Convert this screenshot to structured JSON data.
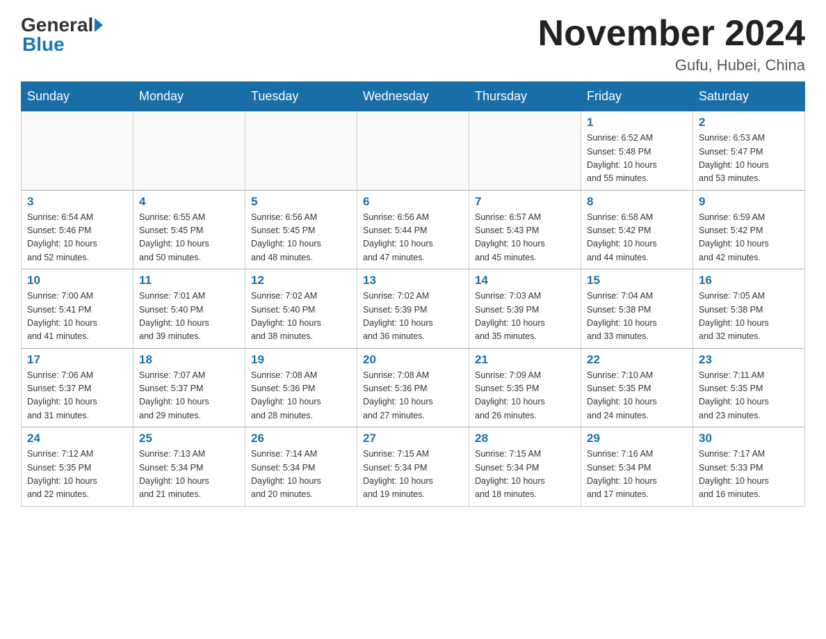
{
  "header": {
    "logo_general": "General",
    "logo_blue": "Blue",
    "title": "November 2024",
    "subtitle": "Gufu, Hubei, China"
  },
  "weekdays": [
    "Sunday",
    "Monday",
    "Tuesday",
    "Wednesday",
    "Thursday",
    "Friday",
    "Saturday"
  ],
  "weeks": [
    [
      {
        "day": "",
        "info": ""
      },
      {
        "day": "",
        "info": ""
      },
      {
        "day": "",
        "info": ""
      },
      {
        "day": "",
        "info": ""
      },
      {
        "day": "",
        "info": ""
      },
      {
        "day": "1",
        "info": "Sunrise: 6:52 AM\nSunset: 5:48 PM\nDaylight: 10 hours\nand 55 minutes."
      },
      {
        "day": "2",
        "info": "Sunrise: 6:53 AM\nSunset: 5:47 PM\nDaylight: 10 hours\nand 53 minutes."
      }
    ],
    [
      {
        "day": "3",
        "info": "Sunrise: 6:54 AM\nSunset: 5:46 PM\nDaylight: 10 hours\nand 52 minutes."
      },
      {
        "day": "4",
        "info": "Sunrise: 6:55 AM\nSunset: 5:45 PM\nDaylight: 10 hours\nand 50 minutes."
      },
      {
        "day": "5",
        "info": "Sunrise: 6:56 AM\nSunset: 5:45 PM\nDaylight: 10 hours\nand 48 minutes."
      },
      {
        "day": "6",
        "info": "Sunrise: 6:56 AM\nSunset: 5:44 PM\nDaylight: 10 hours\nand 47 minutes."
      },
      {
        "day": "7",
        "info": "Sunrise: 6:57 AM\nSunset: 5:43 PM\nDaylight: 10 hours\nand 45 minutes."
      },
      {
        "day": "8",
        "info": "Sunrise: 6:58 AM\nSunset: 5:42 PM\nDaylight: 10 hours\nand 44 minutes."
      },
      {
        "day": "9",
        "info": "Sunrise: 6:59 AM\nSunset: 5:42 PM\nDaylight: 10 hours\nand 42 minutes."
      }
    ],
    [
      {
        "day": "10",
        "info": "Sunrise: 7:00 AM\nSunset: 5:41 PM\nDaylight: 10 hours\nand 41 minutes."
      },
      {
        "day": "11",
        "info": "Sunrise: 7:01 AM\nSunset: 5:40 PM\nDaylight: 10 hours\nand 39 minutes."
      },
      {
        "day": "12",
        "info": "Sunrise: 7:02 AM\nSunset: 5:40 PM\nDaylight: 10 hours\nand 38 minutes."
      },
      {
        "day": "13",
        "info": "Sunrise: 7:02 AM\nSunset: 5:39 PM\nDaylight: 10 hours\nand 36 minutes."
      },
      {
        "day": "14",
        "info": "Sunrise: 7:03 AM\nSunset: 5:39 PM\nDaylight: 10 hours\nand 35 minutes."
      },
      {
        "day": "15",
        "info": "Sunrise: 7:04 AM\nSunset: 5:38 PM\nDaylight: 10 hours\nand 33 minutes."
      },
      {
        "day": "16",
        "info": "Sunrise: 7:05 AM\nSunset: 5:38 PM\nDaylight: 10 hours\nand 32 minutes."
      }
    ],
    [
      {
        "day": "17",
        "info": "Sunrise: 7:06 AM\nSunset: 5:37 PM\nDaylight: 10 hours\nand 31 minutes."
      },
      {
        "day": "18",
        "info": "Sunrise: 7:07 AM\nSunset: 5:37 PM\nDaylight: 10 hours\nand 29 minutes."
      },
      {
        "day": "19",
        "info": "Sunrise: 7:08 AM\nSunset: 5:36 PM\nDaylight: 10 hours\nand 28 minutes."
      },
      {
        "day": "20",
        "info": "Sunrise: 7:08 AM\nSunset: 5:36 PM\nDaylight: 10 hours\nand 27 minutes."
      },
      {
        "day": "21",
        "info": "Sunrise: 7:09 AM\nSunset: 5:35 PM\nDaylight: 10 hours\nand 26 minutes."
      },
      {
        "day": "22",
        "info": "Sunrise: 7:10 AM\nSunset: 5:35 PM\nDaylight: 10 hours\nand 24 minutes."
      },
      {
        "day": "23",
        "info": "Sunrise: 7:11 AM\nSunset: 5:35 PM\nDaylight: 10 hours\nand 23 minutes."
      }
    ],
    [
      {
        "day": "24",
        "info": "Sunrise: 7:12 AM\nSunset: 5:35 PM\nDaylight: 10 hours\nand 22 minutes."
      },
      {
        "day": "25",
        "info": "Sunrise: 7:13 AM\nSunset: 5:34 PM\nDaylight: 10 hours\nand 21 minutes."
      },
      {
        "day": "26",
        "info": "Sunrise: 7:14 AM\nSunset: 5:34 PM\nDaylight: 10 hours\nand 20 minutes."
      },
      {
        "day": "27",
        "info": "Sunrise: 7:15 AM\nSunset: 5:34 PM\nDaylight: 10 hours\nand 19 minutes."
      },
      {
        "day": "28",
        "info": "Sunrise: 7:15 AM\nSunset: 5:34 PM\nDaylight: 10 hours\nand 18 minutes."
      },
      {
        "day": "29",
        "info": "Sunrise: 7:16 AM\nSunset: 5:34 PM\nDaylight: 10 hours\nand 17 minutes."
      },
      {
        "day": "30",
        "info": "Sunrise: 7:17 AM\nSunset: 5:33 PM\nDaylight: 10 hours\nand 16 minutes."
      }
    ]
  ]
}
